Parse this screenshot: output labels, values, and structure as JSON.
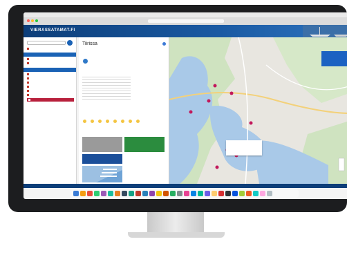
{
  "site": {
    "logo": "VIERASSATAMAT.FI",
    "tagline": "",
    "footer": ""
  },
  "panel": {
    "title": "Tiirissa",
    "subtitle": "",
    "heading_services": "",
    "heading_weather": ""
  },
  "ads": {
    "ad1": "",
    "ad2": "",
    "ad3": ""
  },
  "map": {
    "popup_title": "",
    "popup_link": ""
  },
  "colors": {
    "brand_blue": "#1a62b5",
    "active_red": "#b8203c",
    "lake_blue": "#a9c9e8",
    "forest_green": "#cfe3c0"
  }
}
